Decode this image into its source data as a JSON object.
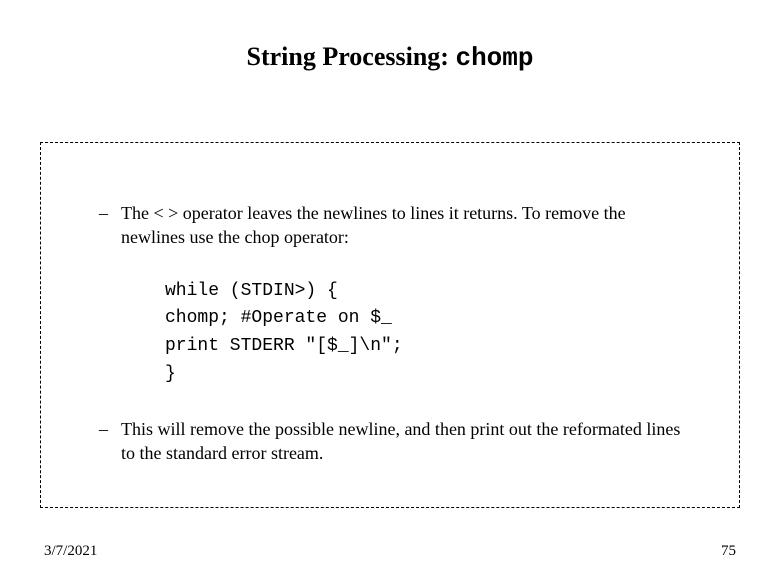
{
  "title": {
    "prefix": "String Processing: ",
    "mono": "chomp"
  },
  "bullets": {
    "b1": "The < > operator leaves the newlines to lines it returns. To remove the newlines use the chop operator:",
    "b2": "This will remove the possible newline, and then print out the reformated lines to the standard error stream."
  },
  "code": {
    "line1": "while (STDIN>) {",
    "line2": "chomp; #Operate on $_",
    "line3": "print STDERR \"[$_]\\n\";",
    "line4": "}"
  },
  "footer": {
    "date": "3/7/2021",
    "page": "75"
  },
  "dash": "–"
}
